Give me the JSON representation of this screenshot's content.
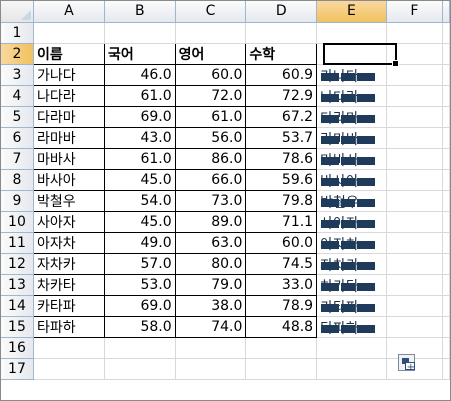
{
  "columns": [
    "A",
    "B",
    "C",
    "D",
    "E",
    "F"
  ],
  "selected_column": "E",
  "rows": [
    "1",
    "2",
    "3",
    "4",
    "5",
    "6",
    "7",
    "8",
    "9",
    "10",
    "11",
    "12",
    "13",
    "14",
    "15",
    "16",
    "17"
  ],
  "selected_row": "2",
  "table": {
    "headers": [
      "이름",
      "국어",
      "영어",
      "수학"
    ],
    "data": [
      [
        "가나다",
        "46.0",
        "60.0",
        "60.9"
      ],
      [
        "나다라",
        "61.0",
        "72.0",
        "72.9"
      ],
      [
        "다라마",
        "69.0",
        "61.0",
        "67.2"
      ],
      [
        "라마바",
        "43.0",
        "56.0",
        "53.7"
      ],
      [
        "마바사",
        "61.0",
        "86.0",
        "78.6"
      ],
      [
        "바사아",
        "45.0",
        "66.0",
        "59.6"
      ],
      [
        "박철우",
        "54.0",
        "73.0",
        "79.8"
      ],
      [
        "사아자",
        "45.0",
        "89.0",
        "71.1"
      ],
      [
        "아자차",
        "49.0",
        "63.0",
        "60.0"
      ],
      [
        "자차카",
        "57.0",
        "80.0",
        "74.5"
      ],
      [
        "차카타",
        "53.0",
        "79.0",
        "33.0"
      ],
      [
        "카타파",
        "69.0",
        "38.0",
        "78.9"
      ],
      [
        "타파하",
        "58.0",
        "74.0",
        "48.8"
      ]
    ]
  },
  "column_e_overflow": [
    "가나다",
    "나다라",
    "다라마",
    "라마바",
    "마바사",
    "바사아",
    "박철우",
    "사아자",
    "아자차",
    "자차카",
    "차카타",
    "카타파",
    "타파하"
  ],
  "colors": {
    "header_selected": "#f1c15f",
    "bar": "#1f3b5c",
    "gridline": "#d9d9d9"
  },
  "icons": {
    "auto_fill_options": "auto-fill-options-icon"
  }
}
